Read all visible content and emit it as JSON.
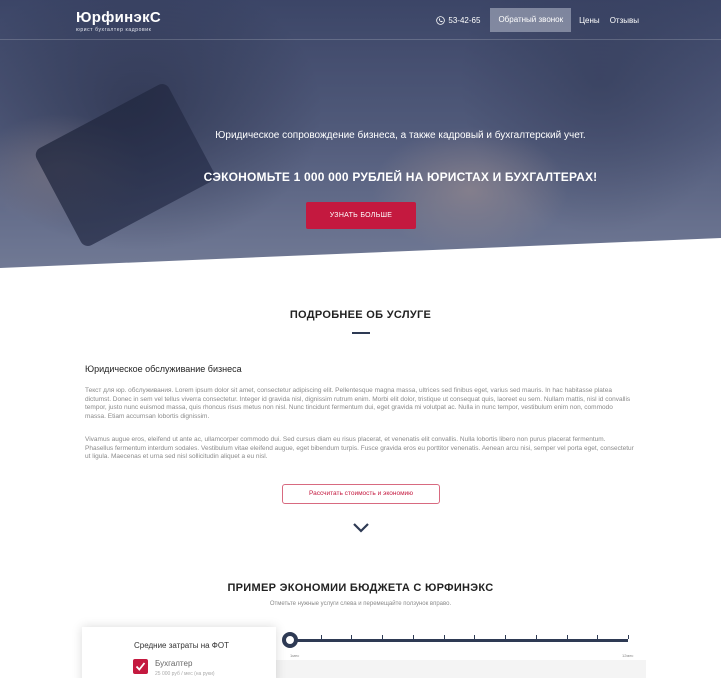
{
  "header": {
    "logo_title": "ЮрфинэкС",
    "logo_sub": "юрист бухгалтер кадровик",
    "phone": "53-42-65",
    "callback_label": "Обратный звонок",
    "nav": [
      "Цены",
      "Отзывы"
    ]
  },
  "hero": {
    "subtitle": "Юридическое сопровождение бизнеса, а также кадровый и бухгалтерский учет.",
    "title": "СЭКОНОМЬТЕ 1 000 000 РУБЛЕЙ НА ЮРИСТАХ И БУХГАЛТЕРАХ!",
    "cta_label": "УЗНАТЬ БОЛЬШЕ"
  },
  "service": {
    "section_title": "ПОДРОБНЕЕ ОБ УСЛУГЕ",
    "heading": "Юридическое обслуживание бизнеса",
    "paragraph1": "Текст для юр. обслуживания. Lorem ipsum dolor sit amet, consectetur adipiscing elit. Pellentesque magna massa, ultrices sed finibus eget, varius sed mauris. In hac habitasse platea dictumst. Donec in sem vel tellus viverra consectetur. Integer id gravida nisl, dignissim rutrum enim. Morbi elit dolor, tristique ut consequat quis, laoreet eu sem. Nullam mattis, nisl id convallis tempor, justo nunc euismod massa, quis rhoncus risus metus non nisl. Nunc tincidunt fermentum dui, eget gravida mi volutpat ac. Nulla in nunc tempor, vestibulum enim non, commodo massa. Etiam accumsan lobortis dignissim.",
    "paragraph2": "Vivamus augue eros, eleifend ut ante ac, ullamcorper commodo dui. Sed cursus diam eu risus placerat, et venenatis elit convallis. Nulla lobortis libero non purus placerat fermentum. Phasellus fermentum interdum sodales. Vestibulum vitae eleifend augue, eget bibendum turpis. Fusce gravida eros eu porttitor venenatis. Aenean arcu nisi, semper vel porta eget, consectetur ut ligula. Maecenas et urna sed nisl sollicitudin aliquet a eu nisl.",
    "calc_button": "Рассчитать стоимость и экономию"
  },
  "savings": {
    "section_title": "ПРИМЕР ЭКОНОМИИ БЮДЖЕТА С ЮРФИНЭКС",
    "subtitle": "Отметьте нужные услуги слева и перемещайте ползунок вправо.",
    "card_title": "Средние затраты на ФОТ",
    "item_label": "Бухгалтер",
    "item_sub": "25 000 руб / мес (на руки)",
    "item_checked": true,
    "slider_min": "1мес",
    "slider_max": "12мес",
    "slider_value": 1
  },
  "colors": {
    "accent": "#c4193f",
    "dark": "#2e3a54"
  }
}
